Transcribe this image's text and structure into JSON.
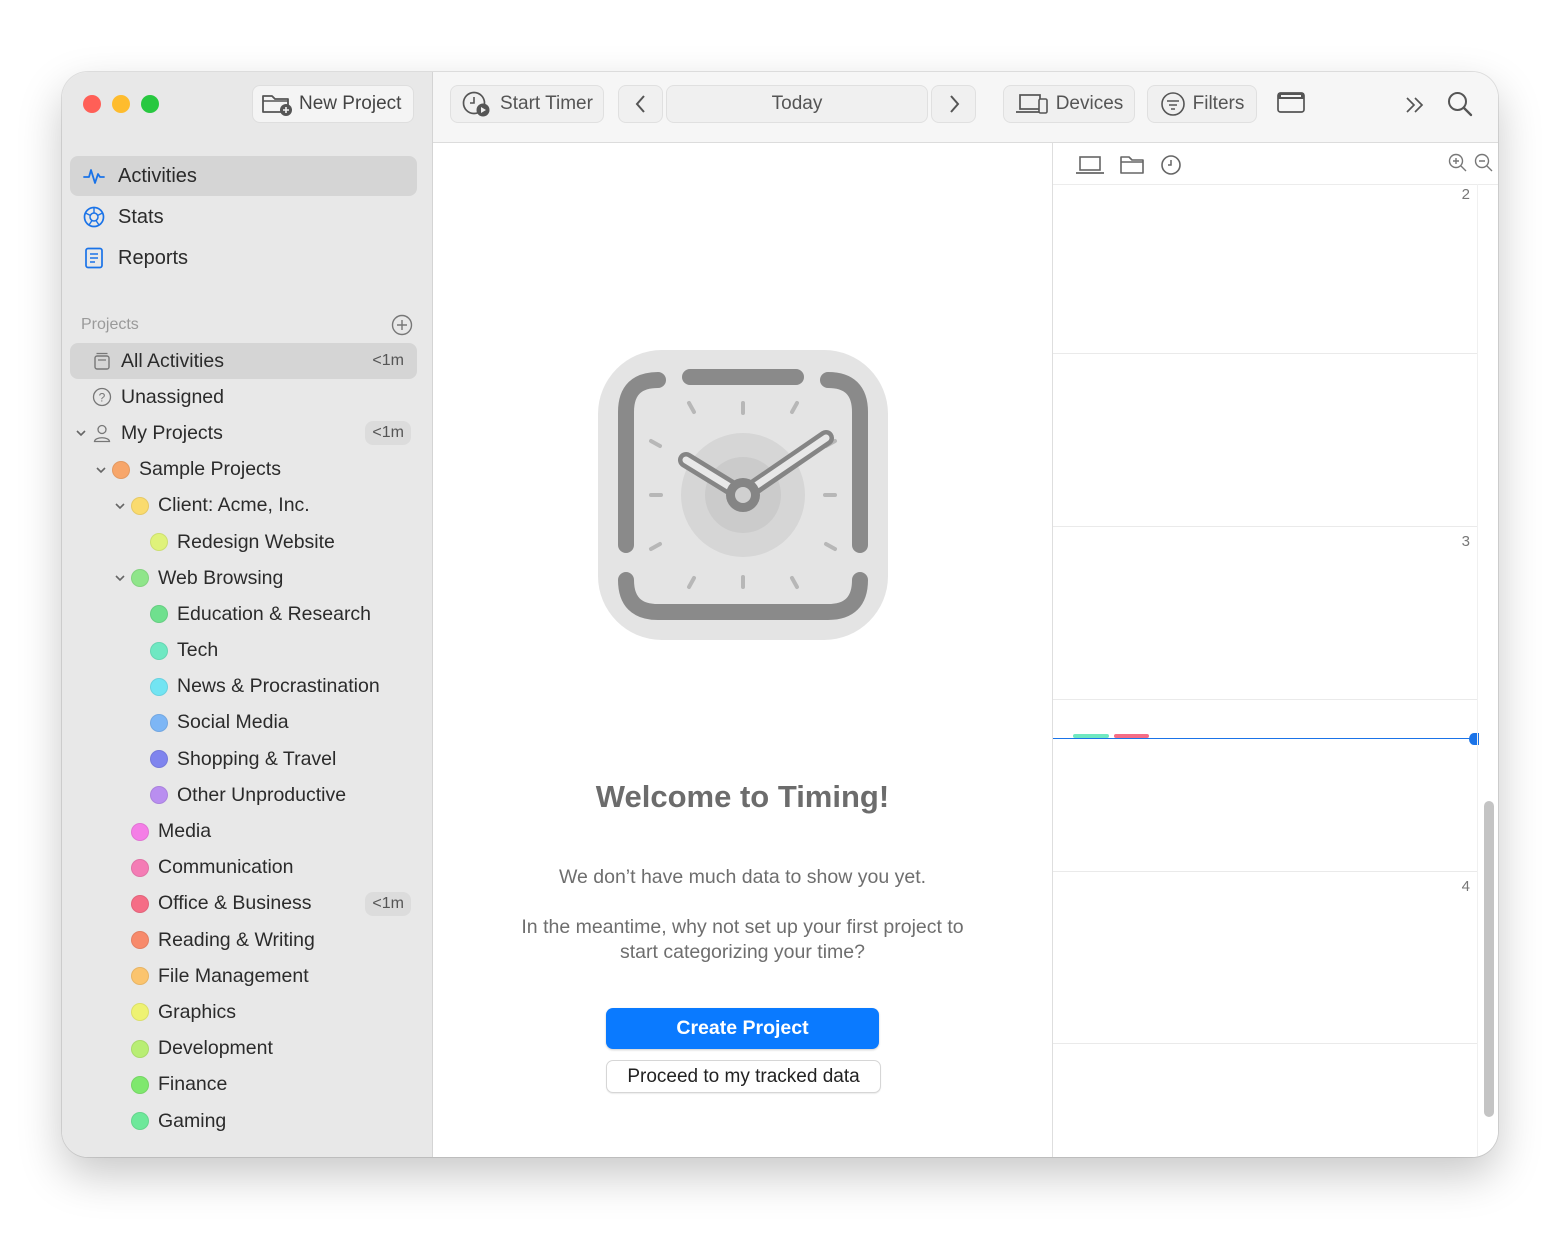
{
  "sidebar": {
    "new_project_label": "New Project",
    "nav": [
      {
        "label": "Activities",
        "icon": "activity-icon"
      },
      {
        "label": "Stats",
        "icon": "stats-icon"
      },
      {
        "label": "Reports",
        "icon": "reports-icon"
      }
    ],
    "projects_header": "Projects",
    "tree": [
      {
        "label": "All Activities",
        "badge": "<1m"
      },
      {
        "label": "Unassigned"
      },
      {
        "label": "My Projects",
        "badge": "<1m"
      },
      {
        "label": "Sample Projects",
        "color": "#f7a66a"
      },
      {
        "label": "Client: Acme, Inc.",
        "color": "#fadb6e"
      },
      {
        "label": "Redesign Website",
        "color": "#dff27a"
      },
      {
        "label": "Web Browsing",
        "color": "#8fe58a"
      },
      {
        "label": "Education & Research",
        "color": "#6fe08e"
      },
      {
        "label": "Tech",
        "color": "#6fe8c2"
      },
      {
        "label": "News & Procrastination",
        "color": "#72e4f2"
      },
      {
        "label": "Social Media",
        "color": "#7db6f5"
      },
      {
        "label": "Shopping & Travel",
        "color": "#7f84ee"
      },
      {
        "label": "Other Unproductive",
        "color": "#b98ef0"
      },
      {
        "label": "Media",
        "color": "#f47ee6"
      },
      {
        "label": "Communication",
        "color": "#f47cb5"
      },
      {
        "label": "Office & Business",
        "color": "#f56d86",
        "badge": "<1m"
      },
      {
        "label": "Reading & Writing",
        "color": "#f78a6b"
      },
      {
        "label": "File Management",
        "color": "#fbc46e"
      },
      {
        "label": "Graphics",
        "color": "#eef272"
      },
      {
        "label": "Development",
        "color": "#b8ee74"
      },
      {
        "label": "Finance",
        "color": "#7fe86e"
      },
      {
        "label": "Gaming",
        "color": "#6de89a"
      }
    ]
  },
  "toolbar": {
    "start_timer": "Start Timer",
    "date": "Today",
    "devices": "Devices",
    "filters": "Filters"
  },
  "main": {
    "welcome": "Welcome to Timing!",
    "no_data": "We don’t have much data to show you yet.",
    "suggest_line1": "In the meantime, why not set up your first project to",
    "suggest_line2": "start categorizing your time?",
    "create_project": "Create Project",
    "proceed": "Proceed to my tracked data"
  },
  "timeline": {
    "hours": [
      "2",
      "3",
      "4"
    ],
    "accent": "#1a73e8"
  }
}
